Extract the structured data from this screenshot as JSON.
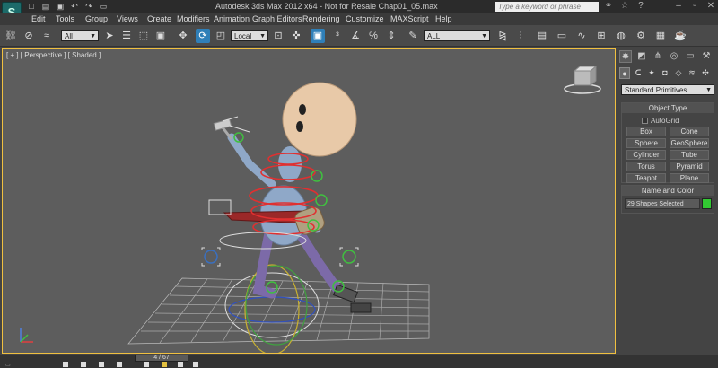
{
  "window": {
    "title": "Autodesk 3ds Max  2012 x64  - Not for Resale   Chap01_05.max",
    "logo_icon": "3dsmax-logo-icon",
    "search_placeholder": "Type a keyword or phrase"
  },
  "quick_access": [
    "new-file-icon",
    "open-file-icon",
    "save-icon",
    "undo-icon",
    "redo-icon",
    "project-folder-icon"
  ],
  "search_tools": [
    "binoculars-icon",
    "star-icon",
    "help-icon"
  ],
  "menu": [
    "Edit",
    "Tools",
    "Group",
    "Views",
    "Create",
    "Modifiers",
    "Animation",
    "Graph Editors",
    "Rendering",
    "Customize",
    "MAXScript",
    "Help"
  ],
  "toolbar": {
    "selection_filter": "All",
    "reference_coord": "Local",
    "named_selection": "ALL"
  },
  "viewport": {
    "label": "[ + ] [ Perspective ] [ Shaded ]",
    "viewcube_face": "TOP"
  },
  "command_panel": {
    "category": "Standard Primitives",
    "object_type": {
      "heading": "Object Type",
      "autogrid_label": "AutoGrid",
      "buttons": [
        "Box",
        "Cone",
        "Sphere",
        "GeoSphere",
        "Cylinder",
        "Tube",
        "Torus",
        "Pyramid",
        "Teapot",
        "Plane"
      ]
    },
    "name_color": {
      "heading": "Name and Color",
      "selection_text": "29 Shapes Selected",
      "color": "#32c832"
    }
  },
  "timeline": {
    "slider_text": "4 / 67"
  },
  "colors": {
    "viewport_border": "#f0c040",
    "active_tool": "#2f7fb8",
    "rig_red": "#e03030",
    "character_head": "#e8c9a8",
    "character_body": "#8fa8c8"
  }
}
